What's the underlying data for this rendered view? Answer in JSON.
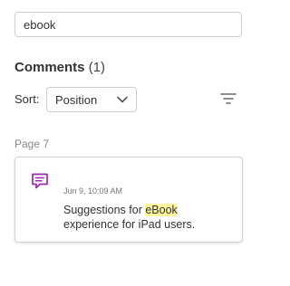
{
  "search": {
    "value": "ebook"
  },
  "comments_section": {
    "title": "Comments",
    "count": "(1)"
  },
  "sort": {
    "label": "Sort:",
    "selected": "Position"
  },
  "icons": {
    "sort_chevron": "chevron-down-icon",
    "filter": "filter-icon",
    "comment": "comment-icon"
  },
  "colors": {
    "comment_icon": "#9c27b0",
    "highlight": "#fff59d"
  },
  "groups": [
    {
      "page_label": "Page 7",
      "comments": [
        {
          "date": "Jun 9, 10:09 AM",
          "text_before": "Suggestions for ",
          "text_match": "eBook",
          "text_after": " experience for iPad users."
        }
      ]
    }
  ]
}
